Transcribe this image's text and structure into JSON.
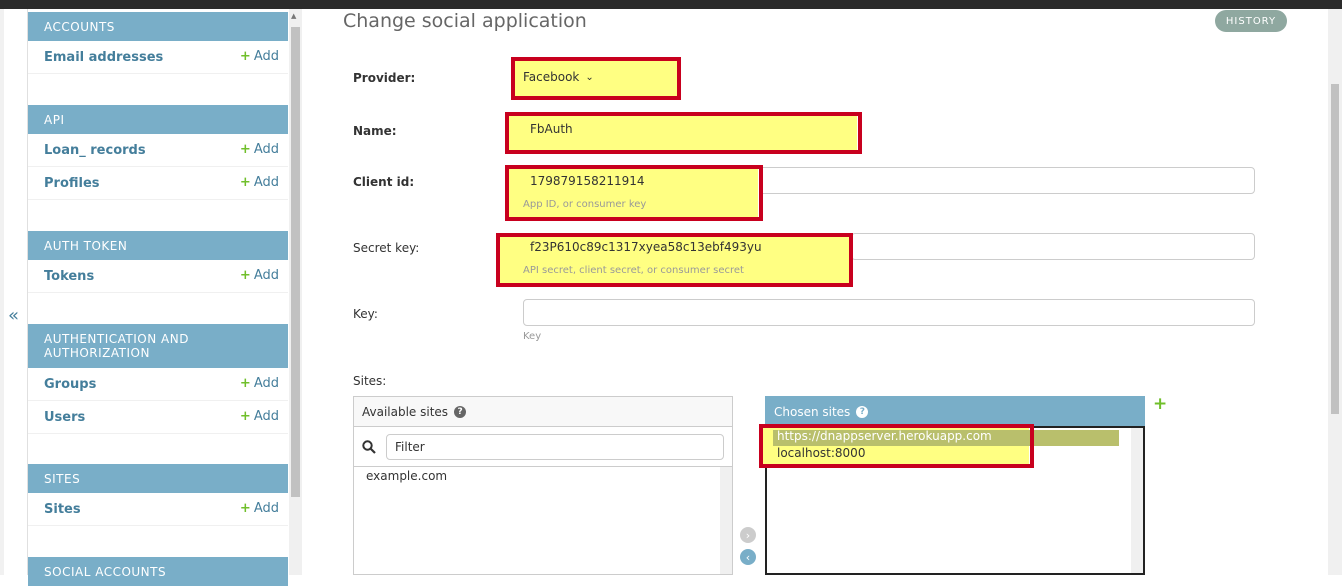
{
  "window": {
    "page_title": "Change social application",
    "history_label": "HISTORY",
    "collapse_glyph": "«"
  },
  "sidebar": {
    "add_label": "Add",
    "modules": [
      {
        "caption": "ACCOUNTS",
        "models": [
          {
            "name": "Email addresses"
          }
        ]
      },
      {
        "caption": "API",
        "models": [
          {
            "name": "Loan_ records"
          },
          {
            "name": "Profiles"
          }
        ]
      },
      {
        "caption": "AUTH TOKEN",
        "models": [
          {
            "name": "Tokens"
          }
        ]
      },
      {
        "caption": "AUTHENTICATION AND AUTHORIZATION",
        "models": [
          {
            "name": "Groups"
          },
          {
            "name": "Users"
          }
        ]
      },
      {
        "caption": "SITES",
        "models": [
          {
            "name": "Sites"
          }
        ]
      },
      {
        "caption": "SOCIAL ACCOUNTS",
        "models": []
      }
    ]
  },
  "form": {
    "provider": {
      "label": "Provider:",
      "value": "Facebook"
    },
    "name": {
      "label": "Name:",
      "value": "FbAuth"
    },
    "client_id": {
      "label": "Client id:",
      "value": "179879158211914",
      "help": "App ID, or consumer key"
    },
    "secret_key": {
      "label": "Secret key:",
      "value": "f23P610c89c1317xyea58c13ebf493yu",
      "help": "API secret, client secret, or consumer secret"
    },
    "key": {
      "label": "Key:",
      "value": "",
      "help": "Key"
    },
    "sites": {
      "label": "Sites:",
      "available_caption": "Available sites",
      "filter_placeholder": "Filter",
      "available_options": [
        "example.com"
      ],
      "chosen_caption": "Chosen sites",
      "chosen_options": [
        "https://dnappserver.herokuapp.com",
        "localhost:8000"
      ]
    }
  },
  "colors": {
    "accent": "#79aec8",
    "link": "#447e9b",
    "add_green": "#70bf2b",
    "highlight": "#ffff82",
    "annotation_red": "#c8001e"
  },
  "icons": {
    "search": "search-icon",
    "help": "help-icon",
    "add": "plus-icon",
    "move_right": "arrow-right-icon",
    "move_left": "arrow-left-icon"
  }
}
